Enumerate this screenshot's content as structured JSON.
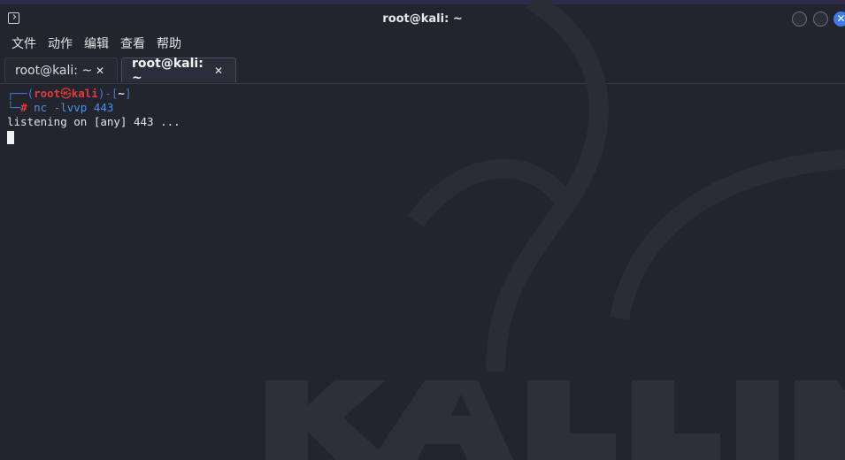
{
  "window": {
    "title": "root@kali: ~",
    "close_glyph": "✕",
    "accent_color": "#3e7ae8"
  },
  "menu": {
    "items": [
      "文件",
      "动作",
      "编辑",
      "查看",
      "帮助"
    ]
  },
  "tabs": [
    {
      "label": "root@kali: ~",
      "close_glyph": "✕",
      "active": false
    },
    {
      "label": "root@kali: ~",
      "close_glyph": "✕",
      "active": true
    }
  ],
  "terminal": {
    "prompt": {
      "open": "┌──(",
      "user": "root",
      "skull": "㉿",
      "host": "kali",
      "mid": ")-[",
      "dir": "~",
      "close": "]",
      "line2_prefix": "└─",
      "hash": "#"
    },
    "command": " nc -lvvp 443",
    "output": "listening on [any] 443 ..."
  },
  "colors": {
    "background": "#23252e",
    "prompt_blue": "#3b7ad9",
    "prompt_red": "#e23a3a"
  }
}
